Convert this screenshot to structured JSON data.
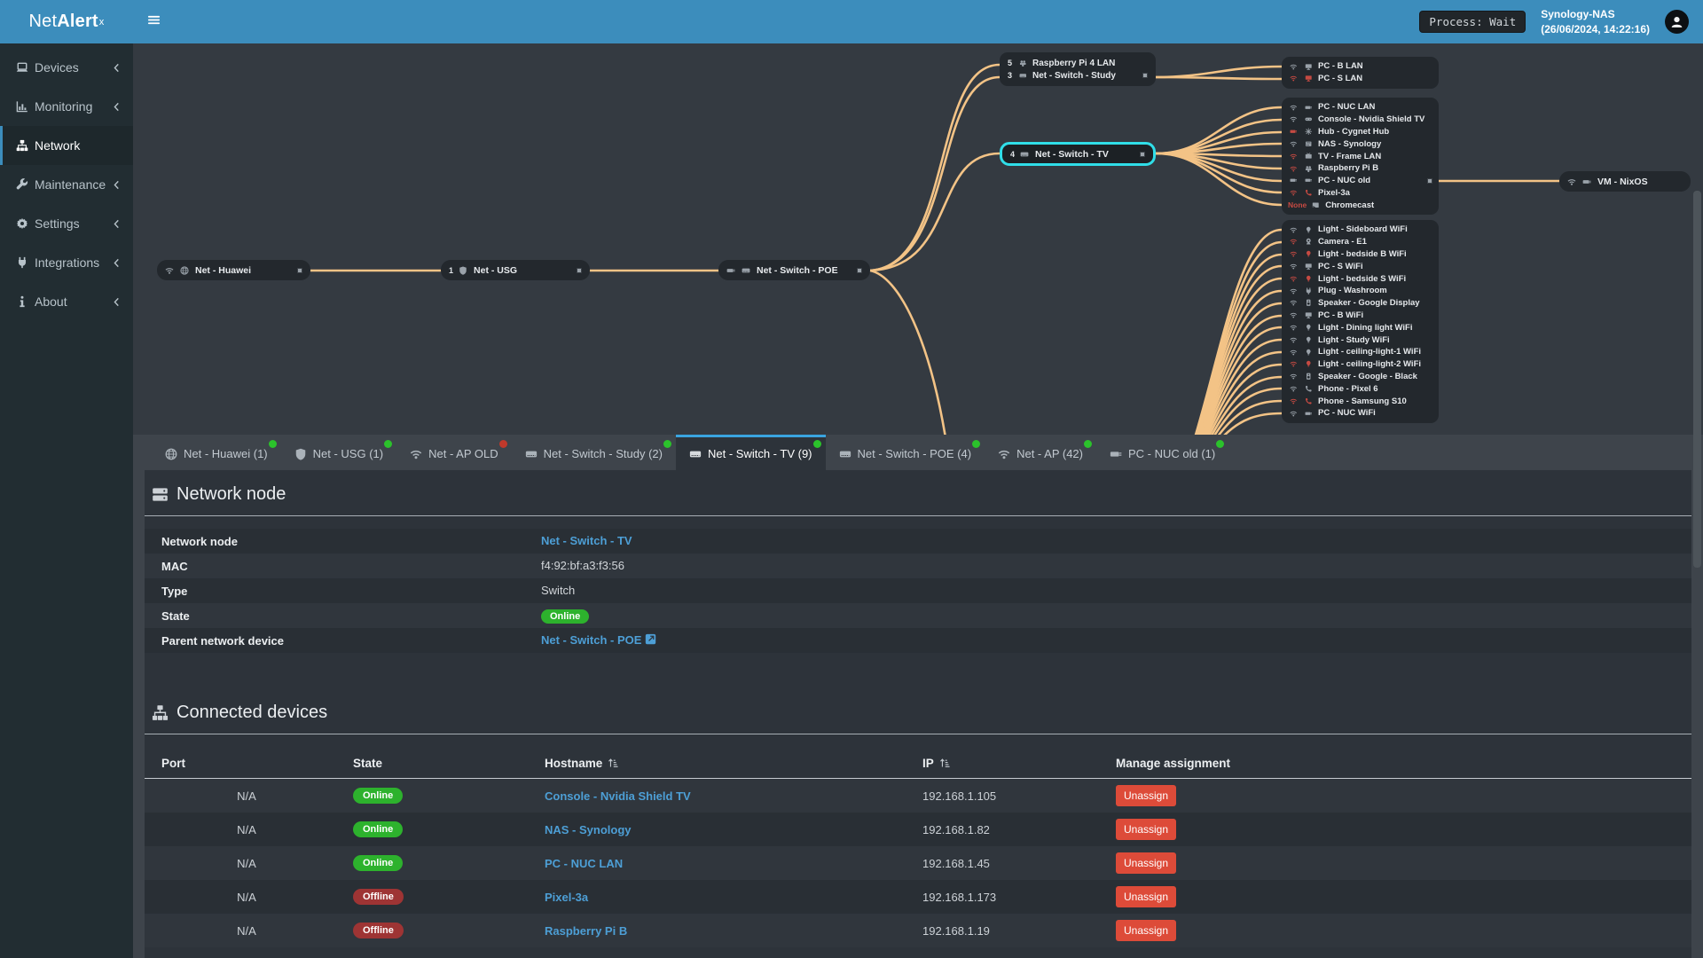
{
  "colors": {
    "accent": "#3c8dbc",
    "link": "#4d9fd6",
    "online": "#2db22d",
    "offline": "#9e3434",
    "danger": "#dd4b39",
    "edge": "#f3c386",
    "selected_node": "#30dee8",
    "tab_dot_green": "#2bc22b",
    "tab_dot_red": "#c0392b"
  },
  "topbar": {
    "logo_thin": "Net",
    "logo_bold": "Alert",
    "logo_sup": "x",
    "hamburger_icon": "hamburger",
    "nav_icons": [
      "arrow-left",
      "arrow-right",
      "sync",
      "move",
      "bell"
    ],
    "process_badge": "Process: Wait",
    "host_name": "Synology-NAS",
    "host_time": "(26/06/2024, 14:22:16)",
    "avatar_icon": "user"
  },
  "sidebar": {
    "items": [
      {
        "icon": "laptop",
        "label": "Devices",
        "chevron": "chevron-left"
      },
      {
        "icon": "chart",
        "label": "Monitoring",
        "chevron": "chevron-left"
      },
      {
        "icon": "sitemap",
        "label": "Network",
        "active": true
      },
      {
        "icon": "wrench",
        "label": "Maintenance",
        "chevron": "chevron-left"
      },
      {
        "icon": "gear",
        "label": "Settings",
        "chevron": "chevron-left"
      },
      {
        "icon": "plug",
        "label": "Integrations",
        "chevron": "chevron-left"
      },
      {
        "icon": "info",
        "label": "About",
        "chevron": "chevron-left"
      }
    ]
  },
  "diagram": {
    "huawei": {
      "icon1": "wifi",
      "icon2": "globe",
      "label": "Net - Huawei"
    },
    "usg": {
      "count": "1",
      "icon1": "shield",
      "label": "Net - USG"
    },
    "poe": {
      "icon1": "eth",
      "icon2": "switch",
      "label": "Net - Switch - POE"
    },
    "stacked": {
      "rows": [
        {
          "count": "5",
          "icon": "raspberry",
          "label": "Raspberry Pi 4 LAN"
        },
        {
          "count": "3",
          "icon": "switch",
          "label": "Net - Switch - Study",
          "port": true
        }
      ]
    },
    "tv": {
      "count": "4",
      "icon": "switch",
      "label": "Net - Switch - TV",
      "selected": true
    },
    "vm": {
      "icon1": "wifi",
      "icon2": "eth",
      "label": "VM - NixOS"
    },
    "groups": {
      "lan": [
        {
          "conn": "wifi",
          "icon": "desktop",
          "label": "PC - B LAN"
        },
        {
          "conn": "wifi",
          "conn_red": true,
          "icon": "desktop",
          "icon_red": true,
          "label": "PC - S LAN"
        }
      ],
      "tv": [
        {
          "conn": "wifi",
          "icon": "eth",
          "label": "PC - NUC LAN"
        },
        {
          "conn": "wifi",
          "icon": "gamepad",
          "label": "Console - Nvidia Shield TV"
        },
        {
          "conn": "eth",
          "conn_red": true,
          "icon": "hub",
          "label": "Hub - Cygnet Hub"
        },
        {
          "conn": "wifi",
          "icon": "nas",
          "label": "NAS - Synology"
        },
        {
          "conn": "wifi",
          "conn_red": true,
          "icon": "tv",
          "label": "TV - Frame LAN"
        },
        {
          "conn": "wifi",
          "conn_red": true,
          "icon": "raspberry",
          "label": "Raspberry Pi B"
        },
        {
          "conn": "eth",
          "icon": "eth",
          "label": "PC - NUC old",
          "port": true
        },
        {
          "conn": "wifi",
          "conn_red": true,
          "icon": "phone",
          "icon_red": true,
          "label": "Pixel-3a"
        },
        {
          "conn_text": "None",
          "icon": "cast",
          "label": "Chromecast"
        }
      ],
      "ap": [
        {
          "conn": "wifi",
          "icon": "bulb",
          "label": "Light - Sideboard WiFi"
        },
        {
          "conn": "wifi",
          "conn_red": true,
          "icon": "camera",
          "label": "Camera - E1"
        },
        {
          "conn": "wifi",
          "conn_red": true,
          "icon": "bulb",
          "icon_red": true,
          "label": "Light - bedside B WiFi"
        },
        {
          "conn": "wifi",
          "icon": "desktop",
          "label": "PC - S WiFi"
        },
        {
          "conn": "wifi",
          "conn_red": true,
          "icon": "bulb",
          "icon_red": true,
          "label": "Light - bedside S WiFi"
        },
        {
          "conn": "wifi",
          "icon": "plug",
          "label": "Plug - Washroom"
        },
        {
          "conn": "wifi",
          "icon": "speaker",
          "label": "Speaker - Google Display"
        },
        {
          "conn": "wifi",
          "icon": "desktop",
          "label": "PC - B WiFi"
        },
        {
          "conn": "wifi",
          "icon": "bulb",
          "label": "Light - Dining light WiFi"
        },
        {
          "conn": "wifi",
          "icon": "bulb",
          "label": "Light - Study WiFi"
        },
        {
          "conn": "wifi",
          "icon": "bulb",
          "label": "Light - ceiling-light-1 WiFi"
        },
        {
          "conn": "wifi",
          "conn_red": true,
          "icon": "bulb",
          "icon_red": true,
          "label": "Light - ceiling-light-2 WiFi"
        },
        {
          "conn": "wifi",
          "icon": "speaker",
          "label": "Speaker - Google - Black"
        },
        {
          "conn": "wifi",
          "icon": "phone",
          "label": "Phone - Pixel 6"
        },
        {
          "conn": "wifi",
          "conn_red": true,
          "icon": "phone",
          "icon_red": true,
          "label": "Phone - Samsung S10"
        },
        {
          "conn": "wifi",
          "icon": "eth",
          "label": "PC - NUC WiFi"
        }
      ]
    }
  },
  "tabs": [
    {
      "icon": "globe",
      "label": "Net - Huawei (1)",
      "dot": "green"
    },
    {
      "icon": "shield",
      "label": "Net - USG (1)",
      "dot": "green"
    },
    {
      "icon": "wifi",
      "label": "Net - AP OLD",
      "dot": "red"
    },
    {
      "icon": "switch",
      "label": "Net - Switch - Study (2)",
      "dot": "green"
    },
    {
      "icon": "switch",
      "label": "Net - Switch - TV (9)",
      "dot": "green",
      "active": true
    },
    {
      "icon": "switch",
      "label": "Net - Switch - POE (4)",
      "dot": "green"
    },
    {
      "icon": "wifi",
      "label": "Net - AP (42)",
      "dot": "green"
    },
    {
      "icon": "eth",
      "label": "PC - NUC old (1)",
      "dot": "green"
    }
  ],
  "node_section": {
    "icon": "server",
    "title": "Network node",
    "rows": [
      {
        "label": "Network node",
        "value": "Net - Switch - TV",
        "style": "link"
      },
      {
        "label": "MAC",
        "value": "f4:92:bf:a3:f3:56",
        "style": "text"
      },
      {
        "label": "Type",
        "value": "Switch",
        "style": "text"
      },
      {
        "label": "State",
        "value": "Online",
        "style": "badge"
      },
      {
        "label": "Parent network device",
        "value": "Net - Switch - POE",
        "style": "linkext",
        "ext_icon": "ext-link"
      }
    ]
  },
  "devices_section": {
    "icon": "sitemap",
    "title": "Connected devices",
    "headers": {
      "port": "Port",
      "state": "State",
      "hostname": "Hostname",
      "ip": "IP",
      "manage": "Manage assignment"
    },
    "sort_icon": "sort",
    "rows": [
      {
        "port": "N/A",
        "state": "Online",
        "hostname": "Console - Nvidia Shield TV",
        "ip": "192.168.1.105",
        "action": "Unassign"
      },
      {
        "port": "N/A",
        "state": "Online",
        "hostname": "NAS - Synology",
        "ip": "192.168.1.82",
        "action": "Unassign"
      },
      {
        "port": "N/A",
        "state": "Online",
        "hostname": "PC - NUC LAN",
        "ip": "192.168.1.45",
        "action": "Unassign"
      },
      {
        "port": "N/A",
        "state": "Offline",
        "hostname": "Pixel-3a",
        "ip": "192.168.1.173",
        "action": "Unassign"
      },
      {
        "port": "N/A",
        "state": "Offline",
        "hostname": "Raspberry Pi B",
        "ip": "192.168.1.19",
        "action": "Unassign"
      }
    ]
  }
}
